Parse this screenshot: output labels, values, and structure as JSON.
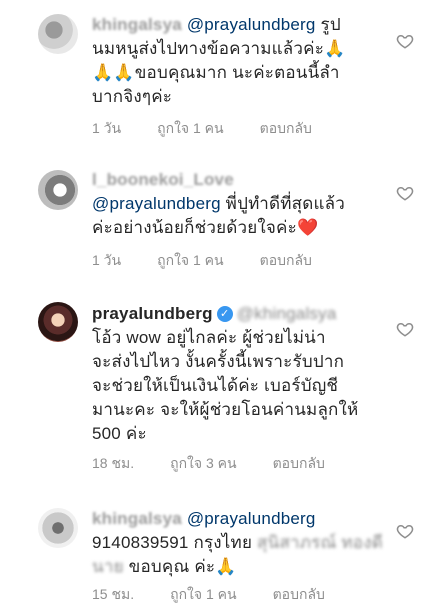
{
  "comments": [
    {
      "username": "khingalsya",
      "mention": "@prayalundberg",
      "text_lines": [
        " รูป",
        "นมหนูส่งไปทางข้อความแล้วค่ะ🙏",
        "🙏🙏ขอบคุณมาก นะค่ะตอนนี้ลำ",
        "บากจิงๆค่ะ"
      ],
      "time": "1 วัน",
      "likes": "ถูกใจ 1 คน",
      "reply": "ตอบกลับ"
    },
    {
      "username": "l_boonekoi_Love",
      "mention": "@prayalundberg",
      "text_lines": [
        " พี่ปูทำดีที่สุดแล้ว",
        "ค่ะอย่างน้อยก็ช่วยด้วยใจค่ะ❤️"
      ],
      "time": "1 วัน",
      "likes": "ถูกใจ 1 คน",
      "reply": "ตอบกลับ"
    },
    {
      "username": "prayalundberg",
      "mention": "@khingalsya",
      "text_lines": [
        "โอ้ว wow อยู่ไกลค่ะ ผู้ช่วยไม่น่า",
        "จะส่งไปไหว งั้นครั้งนี้เพราะรับปาก",
        "จะช่วยให้เป็นเงินได้ค่ะ เบอร์บัญชี",
        "มานะคะ จะให้ผู้ช่วยโอนค่านมลูกให้",
        "500 ค่ะ"
      ],
      "time": "18 ชม.",
      "likes": "ถูกใจ 3 คน",
      "reply": "ตอบกลับ"
    },
    {
      "username": "khingalsya",
      "mention": "@prayalundberg",
      "text_lines": [
        "9140839591 กรุงไทย ",
        "นาย",
        " ขอบคุณ ค่ะ🙏"
      ],
      "redacted_name": "สุนิสาภรณ์ ทองดี",
      "time": "15 ชม.",
      "likes": "ถูกใจ 1 คน",
      "reply": "ตอบกลับ"
    }
  ]
}
